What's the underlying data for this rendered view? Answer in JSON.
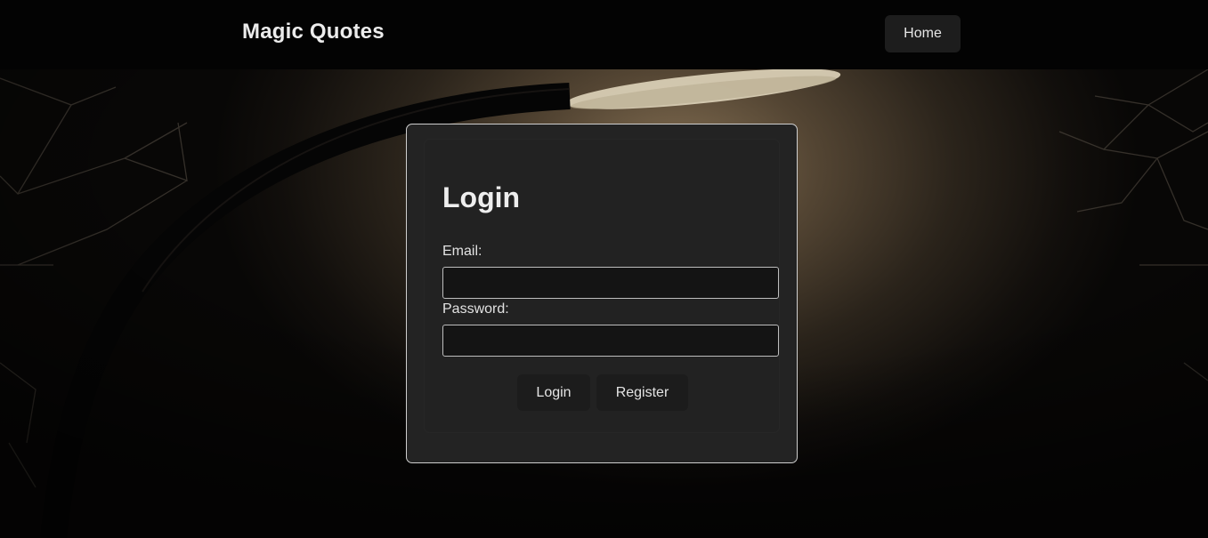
{
  "header": {
    "brand": "Magic Quotes",
    "nav": {
      "home_label": "Home"
    }
  },
  "login_form": {
    "title": "Login",
    "email": {
      "label": "Email:",
      "value": "",
      "placeholder": ""
    },
    "password": {
      "label": "Password:",
      "value": "",
      "placeholder": ""
    },
    "buttons": {
      "login_label": "Login",
      "register_label": "Register"
    }
  },
  "colors": {
    "header_bg": "#030303",
    "card_bg": "#232323",
    "button_bg": "#1c1c1c",
    "input_bg": "#141414"
  }
}
